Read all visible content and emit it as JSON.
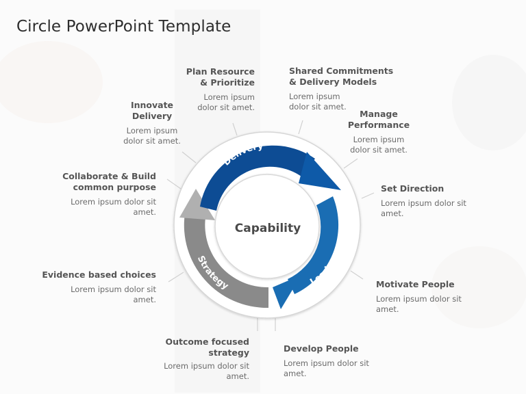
{
  "title": "Circle PowerPoint Template",
  "center_label": "Capability",
  "colors": {
    "delivery": "#0d4c94",
    "delivery_tip": "#0e5aa8",
    "leadership": "#1a6db3",
    "strategy": "#8a8a8a",
    "strategy_tip": "#b0b0b0",
    "ring": "#dcdcdc",
    "text_heading": "#555555",
    "text_body": "#6a6a6a"
  },
  "arrows": [
    {
      "label": "Delivery"
    },
    {
      "label": "Leadership"
    },
    {
      "label": "Strategy"
    }
  ],
  "items": [
    {
      "title_lines": [
        "Plan Resource",
        "& Prioritize"
      ],
      "desc_lines": [
        "Lorem ipsum",
        "dolor sit amet."
      ]
    },
    {
      "title_lines": [
        "Shared Commitments",
        "& Delivery  Models"
      ],
      "desc_lines": [
        "Lorem ipsum",
        "dolor sit amet."
      ]
    },
    {
      "title_lines": [
        "Innovate",
        "Delivery"
      ],
      "desc_lines": [
        "Lorem ipsum",
        "dolor sit amet."
      ]
    },
    {
      "title_lines": [
        "Manage",
        "Performance"
      ],
      "desc_lines": [
        "Lorem ipsum",
        "dolor sit amet."
      ]
    },
    {
      "title_lines": [
        "Collaborate & Build",
        "common purpose"
      ],
      "desc_lines": [
        "Lorem ipsum  dolor sit",
        "amet."
      ]
    },
    {
      "title_lines": [
        "Set Direction"
      ],
      "desc_lines": [
        "Lorem ipsum  dolor sit",
        "amet."
      ]
    },
    {
      "title_lines": [
        "Evidence  based choices"
      ],
      "desc_lines": [
        "Lorem ipsum  dolor sit",
        "amet."
      ]
    },
    {
      "title_lines": [
        "Motivate People"
      ],
      "desc_lines": [
        "Lorem ipsum  dolor sit",
        "amet."
      ]
    },
    {
      "title_lines": [
        "Outcome focused",
        "strategy"
      ],
      "desc_lines": [
        "Lorem ipsum  dolor sit",
        "amet."
      ]
    },
    {
      "title_lines": [
        "Develop People"
      ],
      "desc_lines": [
        "Lorem ipsum  dolor sit",
        "amet."
      ]
    }
  ]
}
